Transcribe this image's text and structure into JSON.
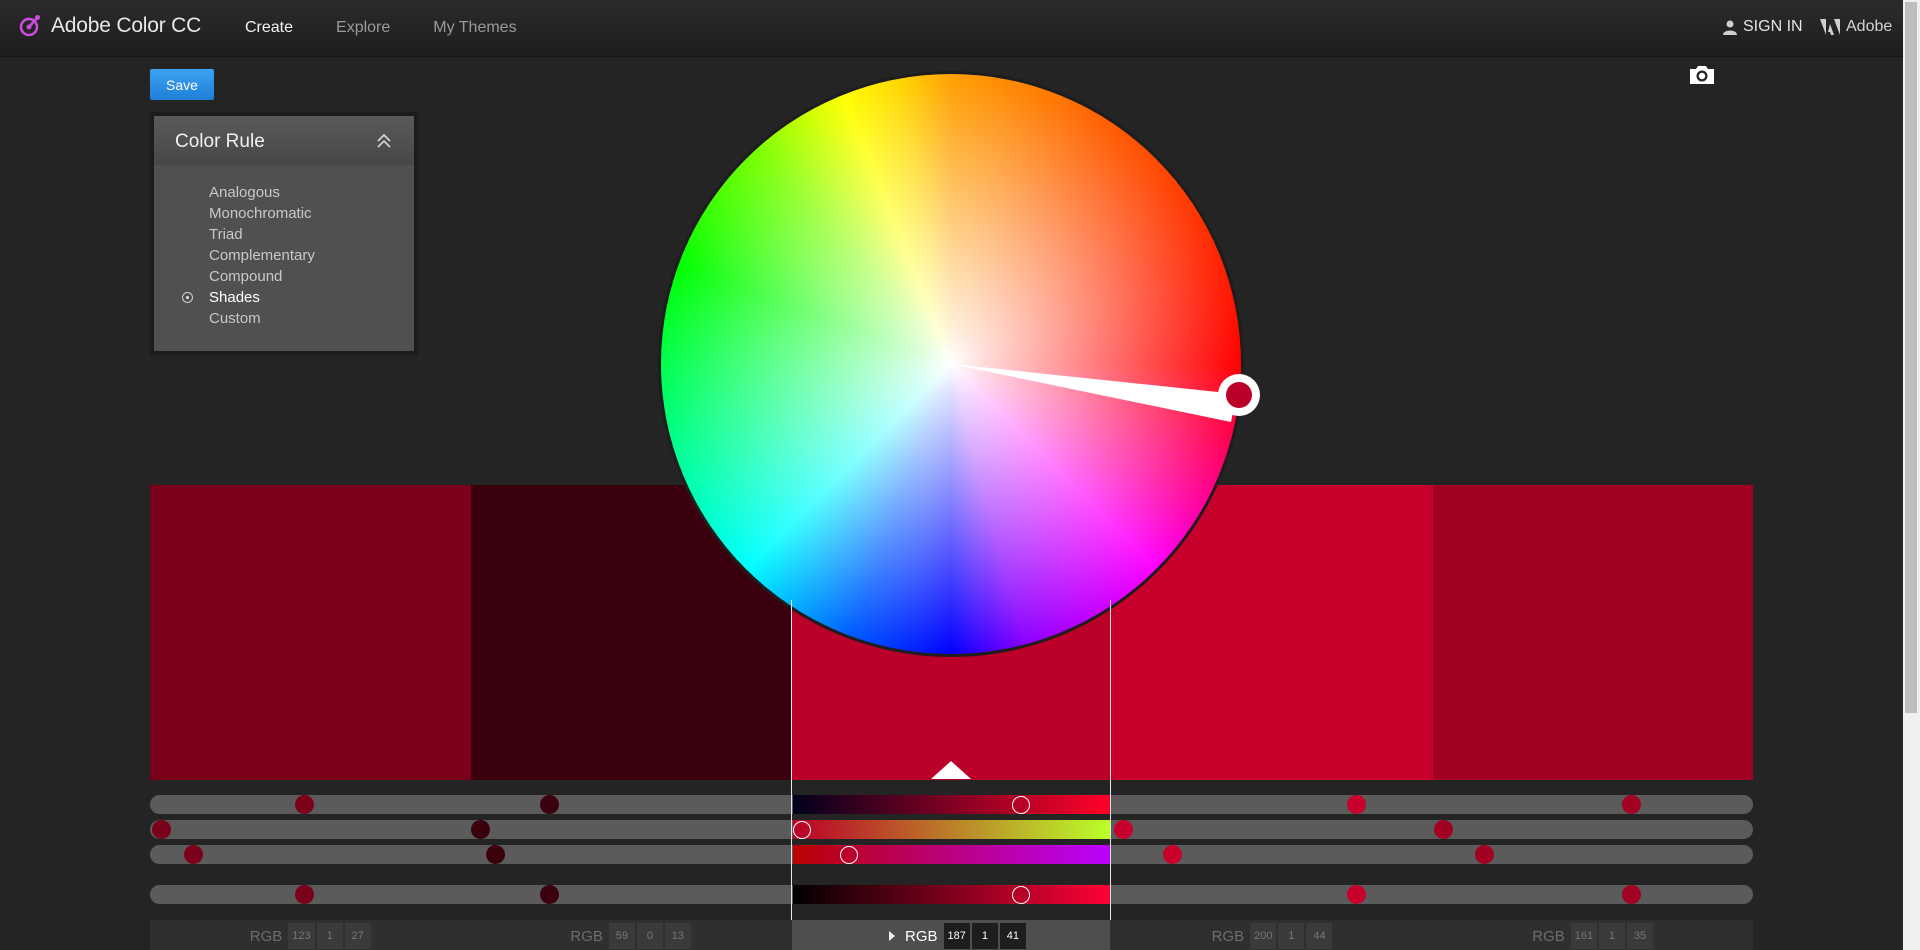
{
  "header": {
    "app_title": "Adobe Color CC",
    "nav": [
      {
        "label": "Create",
        "active": true
      },
      {
        "label": "Explore",
        "active": false
      },
      {
        "label": "My Themes",
        "active": false
      }
    ],
    "sign_in": "SIGN IN",
    "adobe": "Adobe"
  },
  "toolbar": {
    "save_label": "Save",
    "camera_icon": "camera-icon"
  },
  "color_rule": {
    "title": "Color Rule",
    "options": [
      "Analogous",
      "Monochromatic",
      "Triad",
      "Complementary",
      "Compound",
      "Shades",
      "Custom"
    ],
    "selected": "Shades"
  },
  "swatches": [
    {
      "hex": "#7b011b",
      "rgb": [
        "123",
        "1",
        "27"
      ]
    },
    {
      "hex": "#3b000d",
      "rgb": [
        "59",
        "0",
        "13"
      ]
    },
    {
      "hex": "#bb0129",
      "rgb": [
        "187",
        "1",
        "41"
      ]
    },
    {
      "hex": "#c8012c",
      "rgb": [
        "200",
        "1",
        "44"
      ]
    },
    {
      "hex": "#a10123",
      "rgb": [
        "161",
        "1",
        "35"
      ]
    }
  ],
  "selected_swatch_index": 2,
  "color_mode": "RGB",
  "slider_values": {
    "r": [
      0.48,
      0.23,
      0.73,
      0.78,
      0.63
    ],
    "g": [
      0.004,
      0.0,
      0.004,
      0.004,
      0.004
    ],
    "b": [
      0.11,
      0.05,
      0.16,
      0.17,
      0.14
    ],
    "brightness": [
      0.48,
      0.23,
      0.73,
      0.78,
      0.63
    ]
  },
  "colors": {
    "accent": "#1f7fd8",
    "base_color": "#bb0129",
    "background": "#242424"
  }
}
